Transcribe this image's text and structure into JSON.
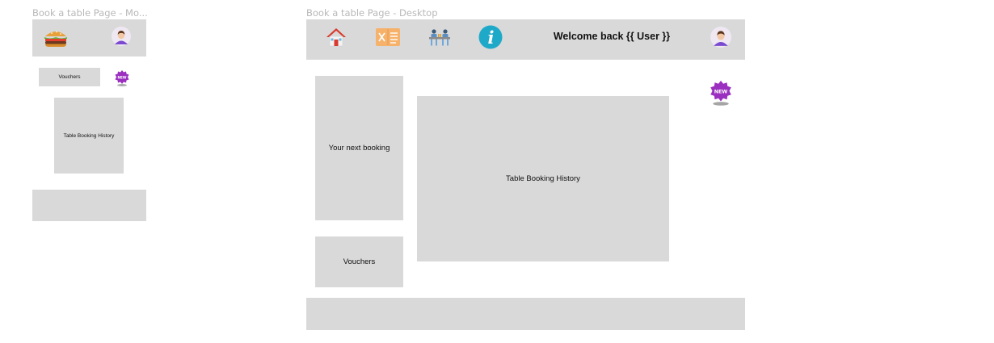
{
  "mobile": {
    "frame_label": "Book a table Page - Mo...",
    "header": {
      "logo_icon": "burger-icon",
      "avatar_icon": "user-avatar-icon"
    },
    "vouchers_label": "Vouchers",
    "new_badge_icon": "new-badge-icon",
    "history_label": "Table Booking History"
  },
  "desktop": {
    "frame_label": "Book a table Page - Desktop",
    "nav": [
      {
        "icon": "home-icon"
      },
      {
        "icon": "menu-icon"
      },
      {
        "icon": "dining-table-icon"
      },
      {
        "icon": "info-icon"
      }
    ],
    "welcome_text": "Welcome back {{ User }}",
    "avatar_icon": "user-avatar-icon",
    "new_badge_icon": "new-badge-icon",
    "new_badge_text": "NEW",
    "next_booking_label": "Your next booking",
    "vouchers_label": "Vouchers",
    "history_label": "Table Booking History"
  },
  "colors": {
    "placeholder_gray": "#d9d9d9",
    "frame_label_gray": "#b8b8b8",
    "badge_purple": "#9b2fc0",
    "info_cyan": "#1fa9c9",
    "menu_orange": "#f6b26b"
  }
}
